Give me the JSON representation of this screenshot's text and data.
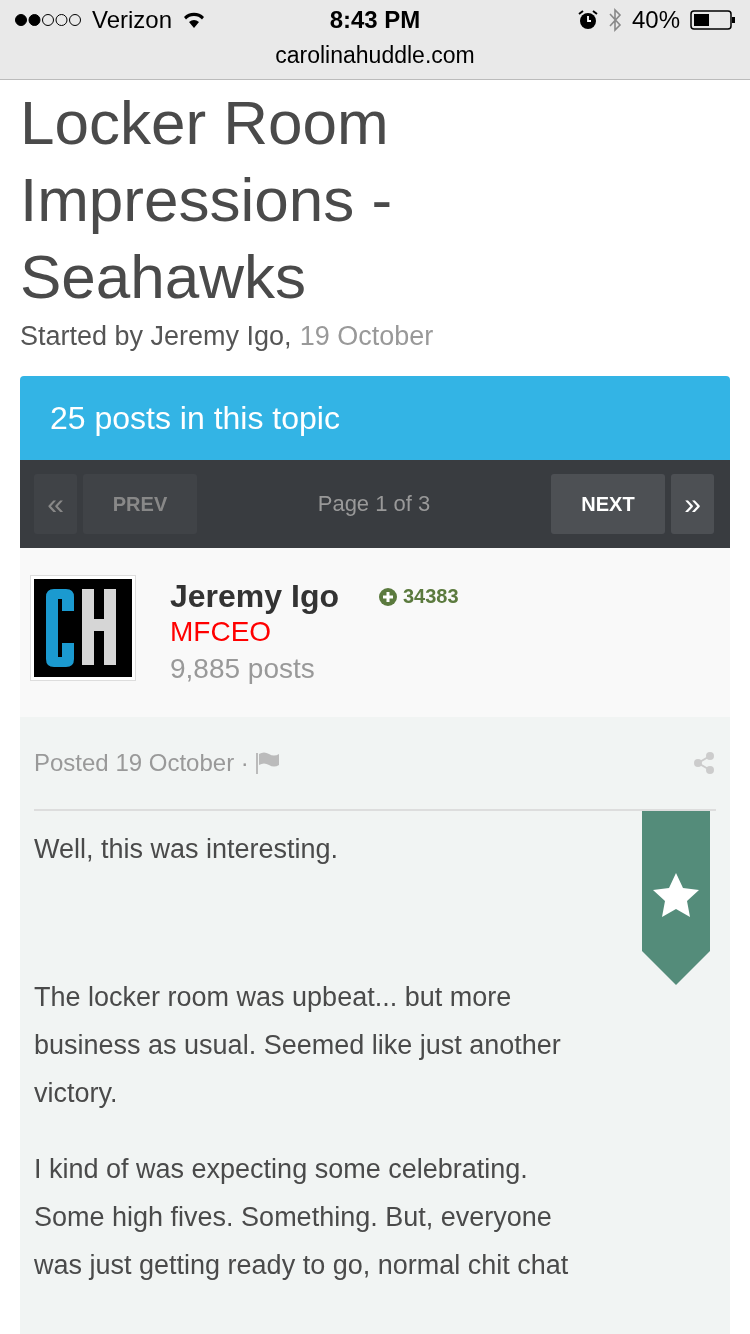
{
  "status_bar": {
    "carrier": "Verizon",
    "time": "8:43 PM",
    "battery": "40%"
  },
  "address_bar": {
    "url": "carolinahuddle.com"
  },
  "topic": {
    "title": "Locker Room Impressions - Seahawks",
    "started_by": "Started by Jeremy Igo,",
    "date": "19 October"
  },
  "posts_header": "25 posts in this topic",
  "pager": {
    "first": {
      "label": "«",
      "disabled": true
    },
    "prev": {
      "label": "PREV",
      "disabled": true
    },
    "page": "Page 1 of 3",
    "next": {
      "label": "NEXT",
      "disabled": false
    },
    "last": {
      "label": "»",
      "disabled": false
    }
  },
  "author": {
    "name": "Jeremy Igo",
    "reputation": "34383",
    "rank": "MFCEO",
    "posts": "9,885 posts"
  },
  "post": {
    "posted": "Posted 19 October ·",
    "featured": true,
    "paragraphs": [
      "Well, this was interesting.",
      "The locker room was upbeat... but more business as usual. Seemed like just another victory.",
      "I kind of was expecting some celebrating. Some high fives. Something. But, everyone was just getting ready to go, normal chit chat"
    ]
  }
}
